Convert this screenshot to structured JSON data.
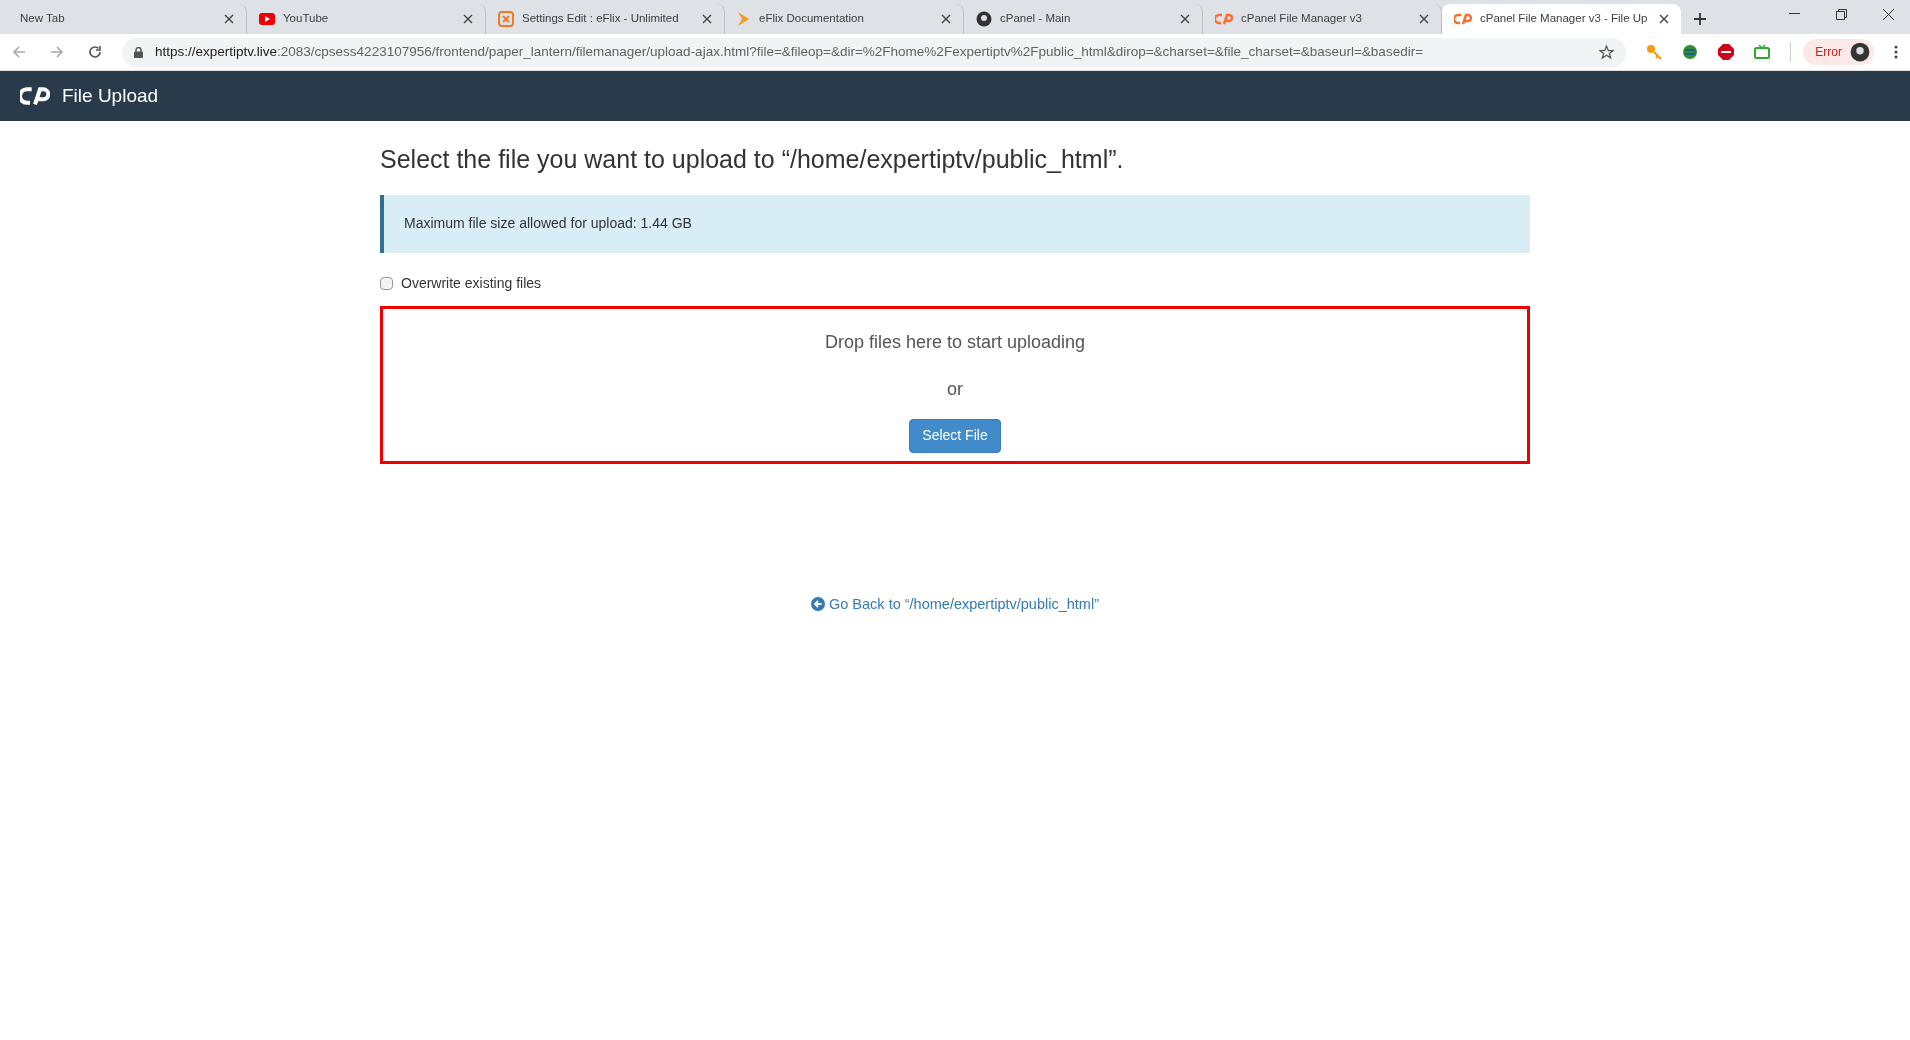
{
  "browser": {
    "tabs": [
      {
        "label": "New Tab",
        "kind": "plain",
        "selected": false
      },
      {
        "label": "YouTube",
        "kind": "video",
        "selected": false
      },
      {
        "label": "Settings Edit : eFlix - Unlimited",
        "kind": "settings",
        "selected": false
      },
      {
        "label": "eFlix Documentation",
        "kind": "docs",
        "selected": false
      },
      {
        "label": "cPanel - Main",
        "kind": "avatar",
        "selected": false
      },
      {
        "label": "cPanel File Manager v3",
        "kind": "cpanel",
        "selected": false
      },
      {
        "label": "cPanel File Manager v3 - File Up",
        "kind": "cpanel",
        "selected": true
      }
    ],
    "address": {
      "host": "https://expertiptv.live",
      "rest": ":2083/cpsess4223107956/frontend/paper_lantern/filemanager/upload-ajax.html?file=&fileop=&dir=%2Fhome%2Fexpertiptv%2Fpublic_html&dirop=&charset=&file_charset=&baseurl=&basedir="
    },
    "profile_status": "Error"
  },
  "header": {
    "title": "File Upload"
  },
  "page": {
    "heading": "Select the file you want to upload to “/home/expertiptv/public_html”.",
    "notice": "Maximum file size allowed for upload: 1.44 GB",
    "overwrite": {
      "label": "Overwrite existing files",
      "checked": false
    },
    "dropzone": {
      "prompt": "Drop files here to start uploading",
      "or": "or",
      "button": "Select File"
    },
    "back_link": "Go Back to “/home/expertiptv/public_html”"
  }
}
